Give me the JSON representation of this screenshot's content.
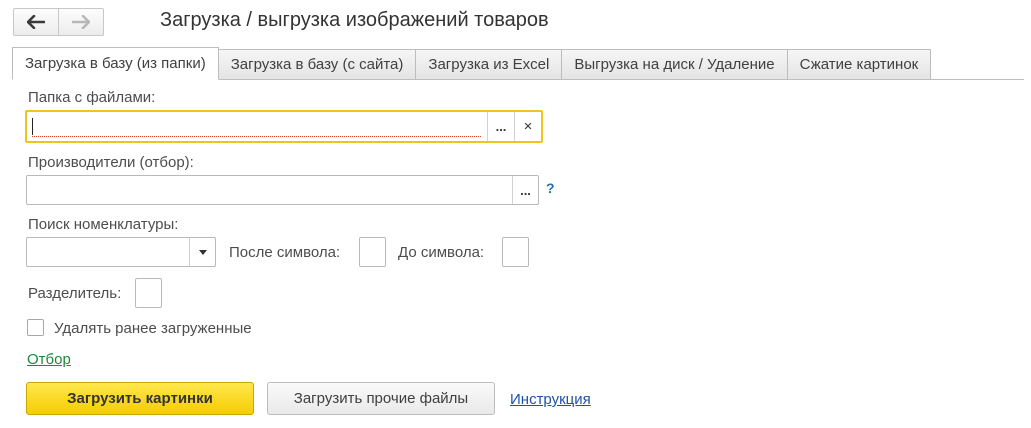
{
  "toolbar": {
    "back_icon": "arrow-left-icon",
    "forward_icon": "arrow-right-icon"
  },
  "window": {
    "title": "Загрузка / выгрузка изображений товаров"
  },
  "tabs": [
    {
      "label": "Загрузка в базу (из папки)",
      "active": true
    },
    {
      "label": "Загрузка в базу (с сайта)",
      "active": false
    },
    {
      "label": "Загрузка из Excel",
      "active": false
    },
    {
      "label": "Выгрузка на диск / Удаление",
      "active": false
    },
    {
      "label": "Сжатие картинок",
      "active": false
    }
  ],
  "form": {
    "folder": {
      "label": "Папка с файлами:",
      "value": "",
      "choose_label": "...",
      "clear_label": "×"
    },
    "manufacturers": {
      "label": "Производители (отбор):",
      "value": "",
      "choose_label": "...",
      "help_label": "?"
    },
    "search": {
      "label": "Поиск номенклатуры:",
      "value": "",
      "dropdown_icon": "triangle-down-icon",
      "after_label": "После символа:",
      "after_value": "",
      "before_label": "До символа:",
      "before_value": ""
    },
    "separator": {
      "label": "Разделитель:",
      "value": ""
    },
    "delete_previous": {
      "label": "Удалять ранее загруженные",
      "checked": false
    },
    "filter_link": "Отбор"
  },
  "actions": {
    "load_images": "Загрузить картинки",
    "load_other": "Загрузить прочие файлы",
    "instruction": "Инструкция"
  },
  "colors": {
    "primary_button": "#f5cd00",
    "focus_border": "#f0c51a",
    "link_green": "#1d8a3a",
    "link_blue": "#2051a8",
    "help_blue": "#1f6fb2"
  }
}
